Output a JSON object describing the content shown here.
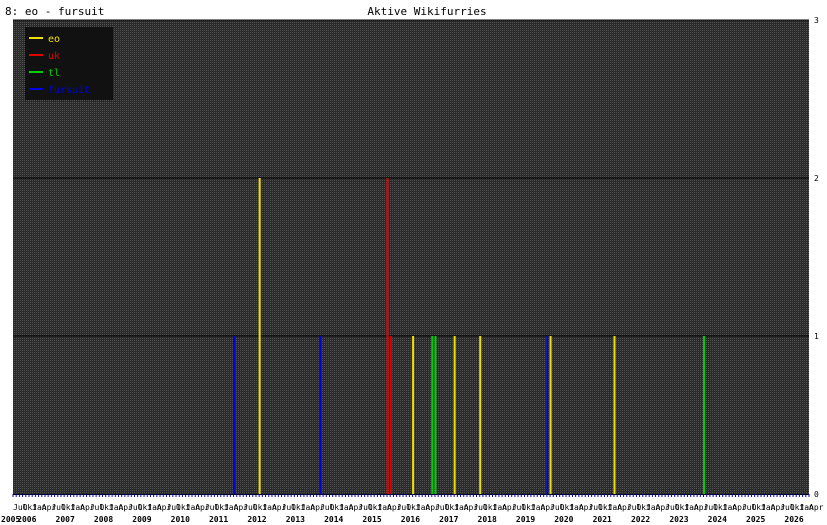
{
  "header": {
    "left_title": "8: eo - fursuit",
    "center_title": "Aktive Wikifurries"
  },
  "chart_data": {
    "type": "bar",
    "title": "Aktive Wikifurries",
    "subtitle": "8: eo - fursuit",
    "ylim": [
      0,
      3
    ],
    "yticks": [
      0,
      1,
      2,
      3
    ],
    "xrange": [
      "2005-07",
      "2026-04"
    ],
    "grid": true,
    "legend_position": "top-left",
    "month_labels": [
      "Jul",
      "Okt",
      "Jan",
      "Apr"
    ],
    "year_labels": [
      "2005",
      "2006",
      "2007",
      "2008",
      "2009",
      "2010",
      "2011",
      "2012",
      "2013",
      "2014",
      "2015",
      "2016",
      "2017",
      "2018",
      "2019",
      "2020",
      "2021",
      "2022",
      "2023",
      "2024",
      "2025",
      "2026"
    ],
    "series": [
      {
        "name": "eo",
        "color": "#f0e000",
        "points": [
          {
            "x": "2011-12",
            "y": 2
          },
          {
            "x": "2015-12",
            "y": 1
          },
          {
            "x": "2017-01",
            "y": 1
          },
          {
            "x": "2017-09",
            "y": 1
          },
          {
            "x": "2019-07",
            "y": 1
          },
          {
            "x": "2021-03",
            "y": 1
          }
        ]
      },
      {
        "name": "uk",
        "color": "#e00000",
        "points": [
          {
            "x": "2015-04",
            "y": 2
          },
          {
            "x": "2015-05",
            "y": 1
          }
        ]
      },
      {
        "name": "tl",
        "color": "#00d000",
        "points": [
          {
            "x": "2016-06",
            "y": 1
          },
          {
            "x": "2016-07",
            "y": 1
          },
          {
            "x": "2023-07",
            "y": 1
          }
        ]
      },
      {
        "name": "fursuit",
        "color": "#0000e0",
        "points": [
          {
            "x": "2011-04",
            "y": 1
          },
          {
            "x": "2013-07",
            "y": 1
          },
          {
            "x": "2019-06",
            "y": 1
          }
        ]
      }
    ]
  }
}
